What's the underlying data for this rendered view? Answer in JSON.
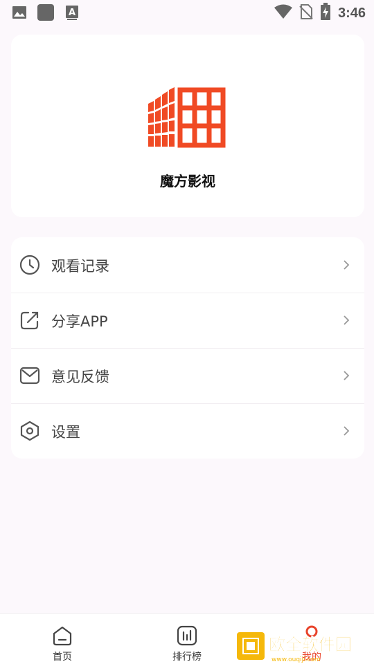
{
  "status_bar": {
    "time": "3:46",
    "icons": [
      "image-icon",
      "app-square-icon",
      "text-a-icon",
      "wifi-icon",
      "no-sim-icon",
      "battery-charging-icon"
    ]
  },
  "profile": {
    "app_name": "魔方影视",
    "logo_icon": "rubik-grid-logo",
    "brand_color": "#f04a24"
  },
  "menu": {
    "items": [
      {
        "label": "观看记录",
        "icon": "clock-icon"
      },
      {
        "label": "分享APP",
        "icon": "share-icon"
      },
      {
        "label": "意见反馈",
        "icon": "mail-icon"
      },
      {
        "label": "设置",
        "icon": "hexagon-settings-icon"
      }
    ]
  },
  "bottom_nav": {
    "items": [
      {
        "label": "首页",
        "icon": "home-icon",
        "active": false
      },
      {
        "label": "排行榜",
        "icon": "chart-icon",
        "active": false
      },
      {
        "label": "我的",
        "icon": "profile-icon",
        "active": true
      }
    ],
    "active_color": "#e8432a"
  },
  "watermark": {
    "text": "欧全软件园",
    "url_text": "www.ouqiji.com",
    "icon": "watermark-logo-icon"
  }
}
